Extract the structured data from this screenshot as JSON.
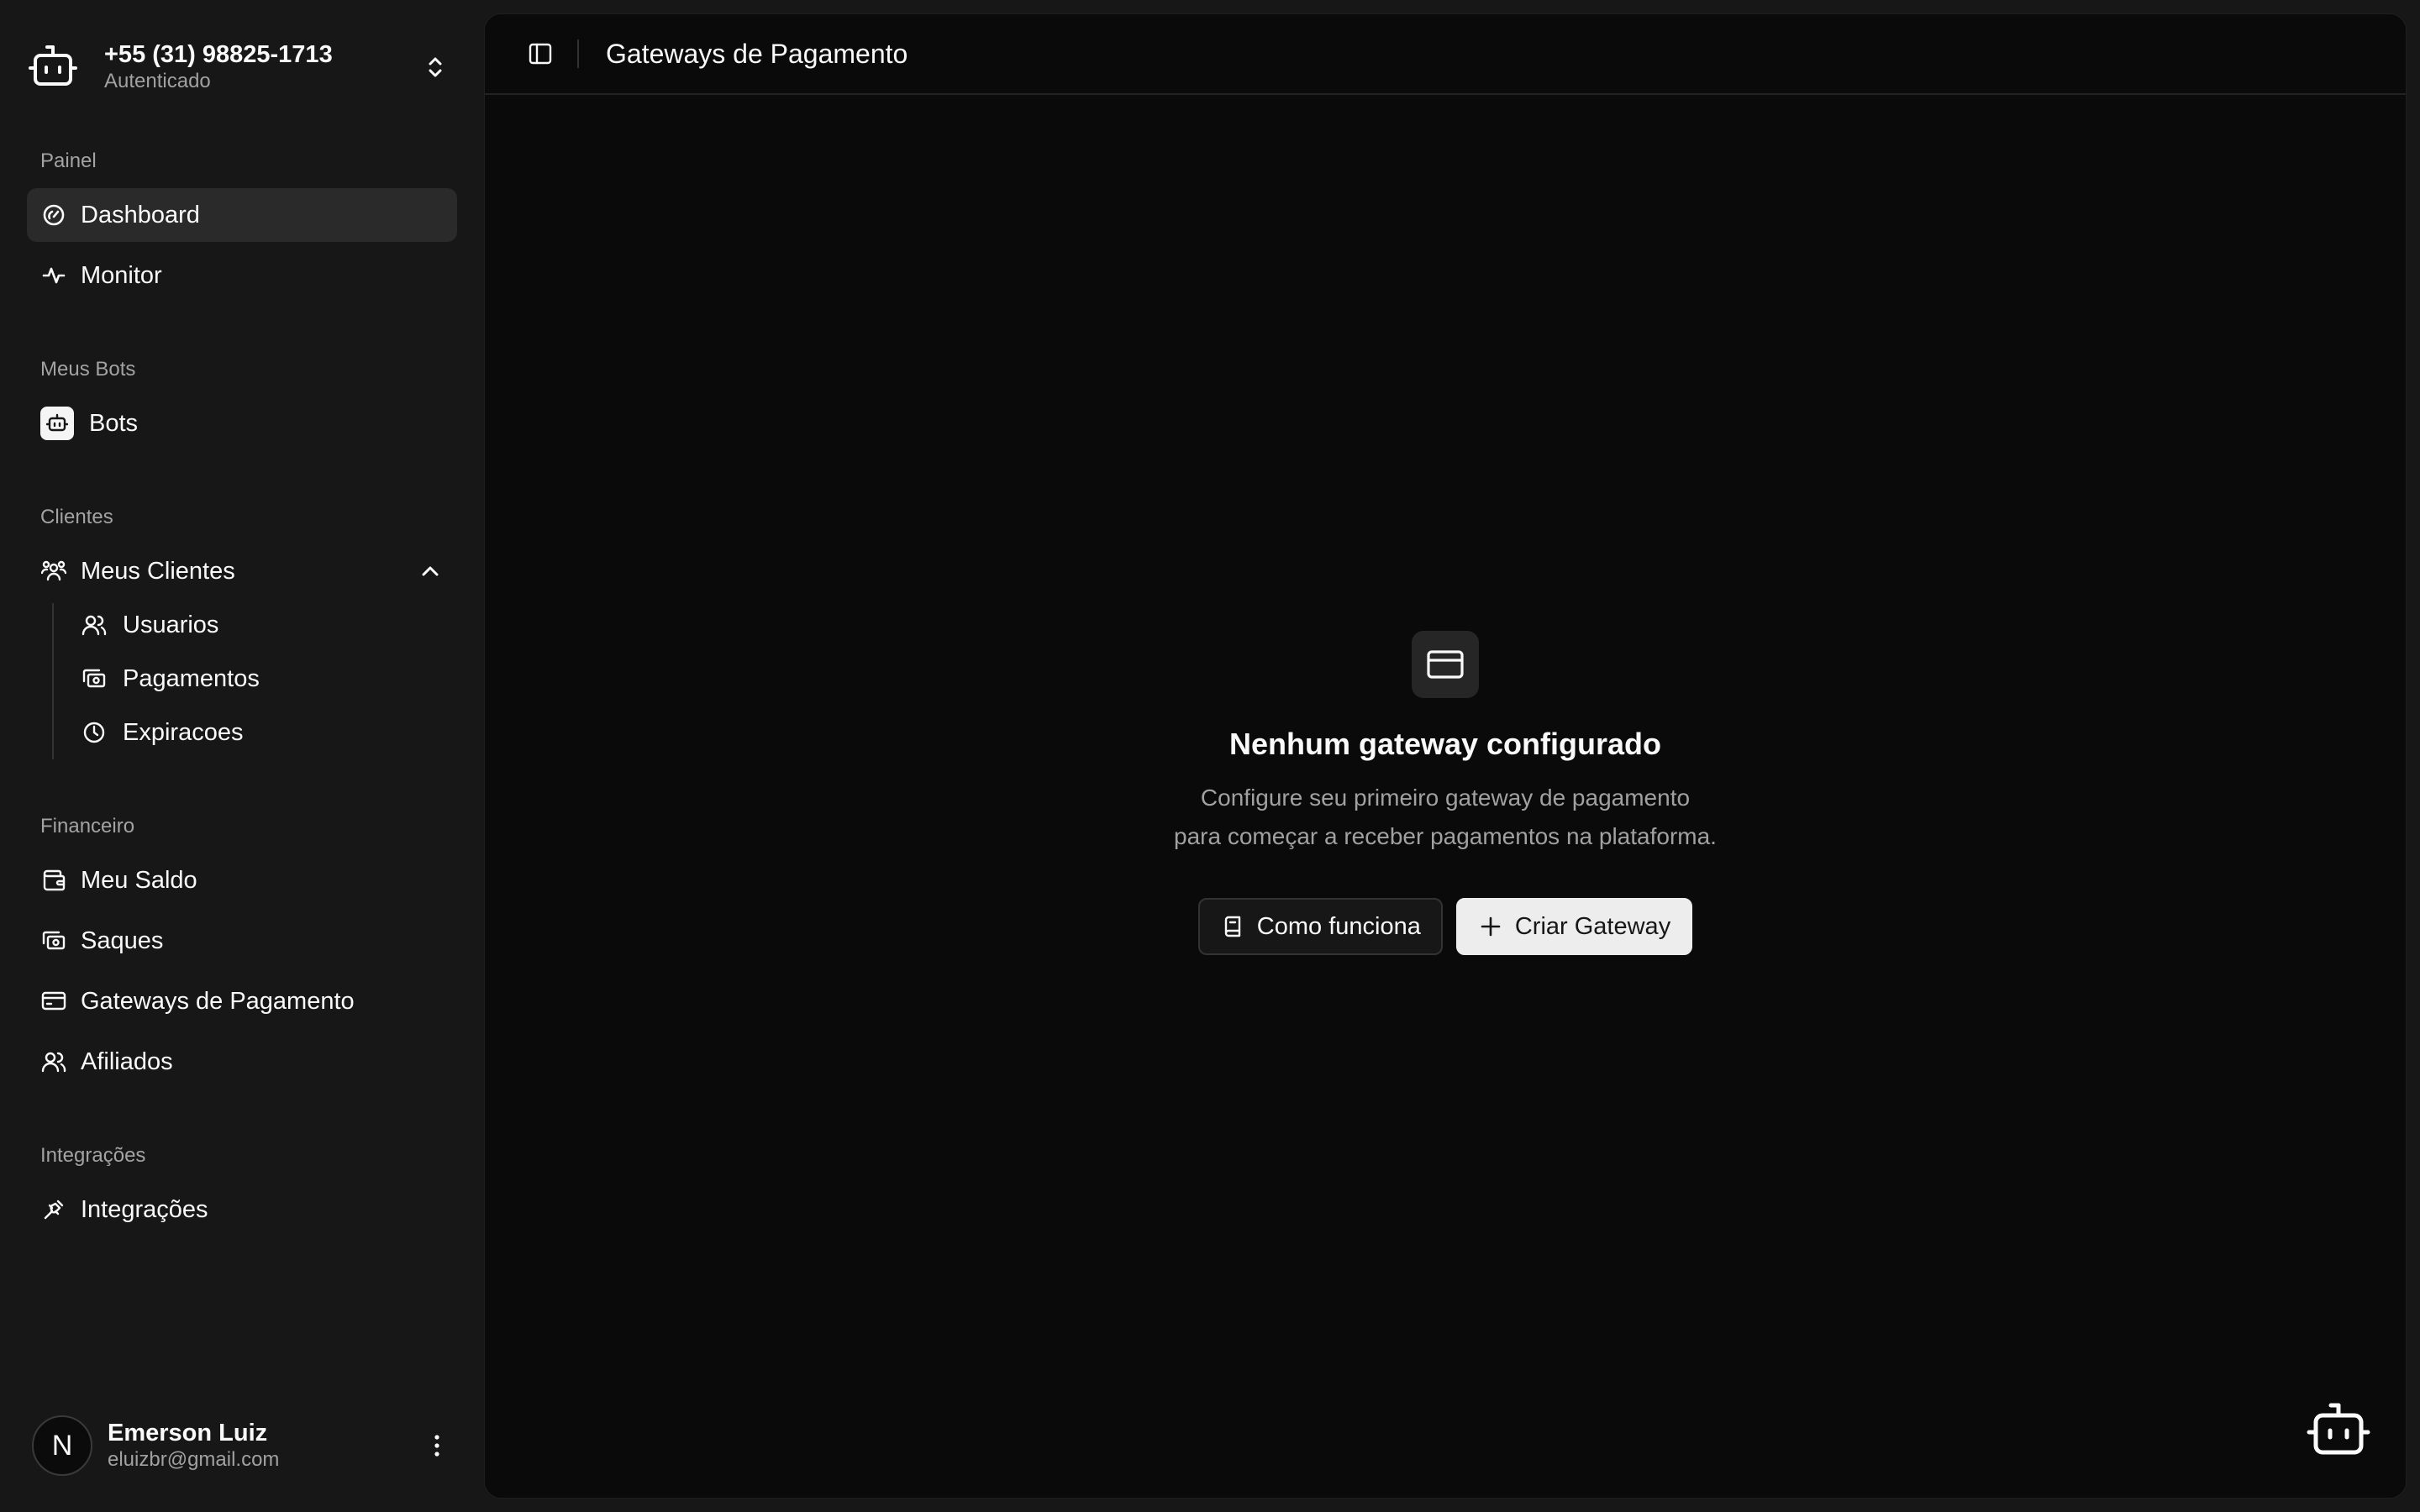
{
  "account": {
    "phone": "+55 (31) 98825-1713",
    "status": "Autenticado"
  },
  "sidebar": {
    "groups": [
      {
        "label": "Painel"
      },
      {
        "label": "Meus Bots"
      },
      {
        "label": "Clientes"
      },
      {
        "label": "Financeiro"
      },
      {
        "label": "Integrações"
      }
    ],
    "items": {
      "dashboard": "Dashboard",
      "monitor": "Monitor",
      "bots": "Bots",
      "meus_clientes": "Meus Clientes",
      "usuarios": "Usuarios",
      "pagamentos": "Pagamentos",
      "expiracoes": "Expiracoes",
      "meu_saldo": "Meu Saldo",
      "saques": "Saques",
      "gateways": "Gateways de Pagamento",
      "afiliados": "Afiliados",
      "integracoes": "Integrações"
    },
    "active_item": "dashboard"
  },
  "user": {
    "initial": "N",
    "name": "Emerson Luiz",
    "email": "eluizbr@gmail.com"
  },
  "header": {
    "title": "Gateways de Pagamento"
  },
  "empty_state": {
    "title": "Nenhum gateway configurado",
    "description_line1": "Configure seu primeiro gateway de pagamento",
    "description_line2": "para começar a receber pagamentos na plataforma.",
    "secondary_button": "Como funciona",
    "primary_button": "Criar Gateway"
  },
  "colors": {
    "sidebar_bg": "#171717",
    "main_bg": "#0a0a0a",
    "active_item_bg": "#2a2a2a",
    "primary_button_bg": "#ededed",
    "muted_text": "#a1a1a1"
  }
}
